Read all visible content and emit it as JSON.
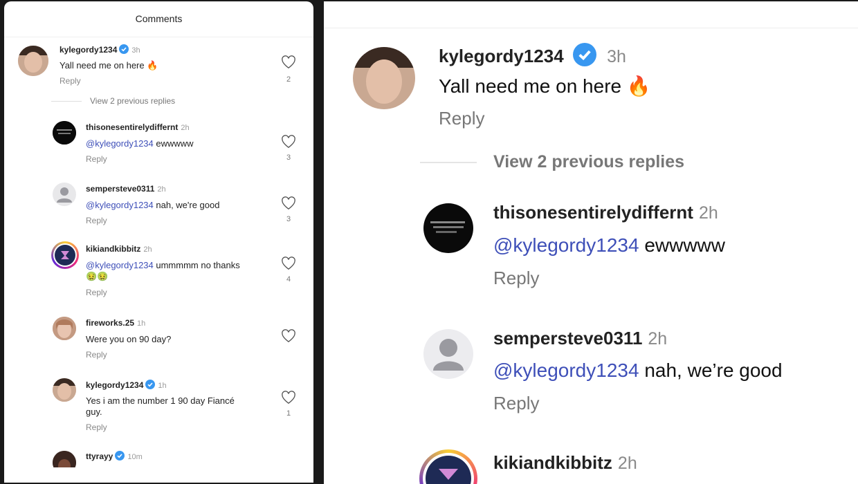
{
  "left": {
    "title": "Comments",
    "view_previous": "View 2 previous replies",
    "reply_label": "Reply",
    "comments": [
      {
        "user": "kylegordy1234",
        "verified": true,
        "time": "3h",
        "text": "Yall need me on here 🔥",
        "likes": "2"
      },
      {
        "user": "thisonesentirelydiffernt",
        "verified": false,
        "time": "2h",
        "mention": "@kylegordy1234",
        "text": " ewwwww",
        "likes": "3"
      },
      {
        "user": "sempersteve0311",
        "verified": false,
        "time": "2h",
        "mention": "@kylegordy1234",
        "text": " nah, we're good",
        "likes": "3"
      },
      {
        "user": "kikiandkibbitz",
        "verified": false,
        "time": "2h",
        "mention": "@kylegordy1234",
        "text": " ummmmm no thanks",
        "text2": "🤢🤢",
        "likes": "4"
      },
      {
        "user": "fireworks.25",
        "verified": false,
        "time": "1h",
        "text": "Were you on 90 day?",
        "likes": ""
      },
      {
        "user": "kylegordy1234",
        "verified": true,
        "time": "1h",
        "text": "Yes i am the number 1 90 day Fiancé",
        "text2": "guy.",
        "likes": "1"
      },
      {
        "user": "ttyrayy",
        "verified": true,
        "time": "10m"
      }
    ]
  },
  "right": {
    "view_previous": "View 2 previous replies",
    "reply_label": "Reply",
    "comments": [
      {
        "user": "kylegordy1234",
        "time": "3h",
        "text": "Yall need me on here 🔥"
      },
      {
        "user": "thisonesentirelydiffernt",
        "time": "2h",
        "mention": "@kylegordy1234",
        "text": " ewwwww"
      },
      {
        "user": "sempersteve0311",
        "time": "2h",
        "mention": "@kylegordy1234",
        "text": " nah, we’re good"
      },
      {
        "user": "kikiandkibbitz",
        "time": "2h"
      }
    ]
  },
  "colors": {
    "mention": "#3e4fb8",
    "verified": "#3897f0"
  }
}
